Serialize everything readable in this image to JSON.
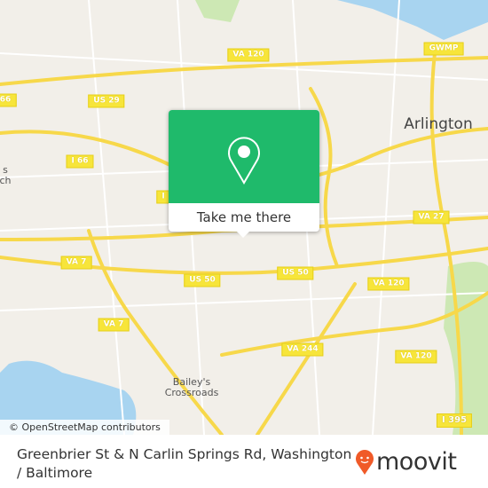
{
  "map": {
    "attribution": "© OpenStreetMap contributors",
    "shields": [
      "VA 120",
      "GWMP",
      "US 29",
      "I 66",
      "I 66",
      "66",
      "I",
      "VA 27",
      "VA 7",
      "VA 7",
      "US 50",
      "US 50",
      "VA 120",
      "VA 120",
      "VA 244",
      "I 395"
    ],
    "places": [
      "Arlington",
      "s\nch",
      "Bailey's\nCrossroads"
    ],
    "colors": {
      "land": "#f2efe9",
      "water": "#a8d4f0",
      "park": "#cde8b4",
      "highway": "#f7e53a",
      "popup": "#1fba6b",
      "brand": "#f05a28"
    }
  },
  "popup": {
    "icon": "map-pin-icon",
    "button_label": "Take me there"
  },
  "footer": {
    "title": "Greenbrier St & N Carlin Springs Rd, Washington / Baltimore",
    "brand": "moovit"
  }
}
